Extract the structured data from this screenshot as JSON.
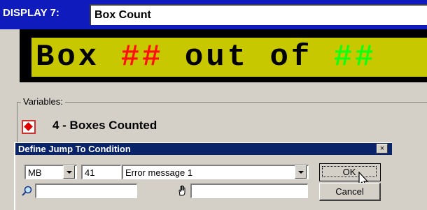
{
  "display": {
    "label": "DISPLAY 7:",
    "name": "Box Count"
  },
  "led": {
    "part1": "Box ",
    "part2": "##",
    "part3": " out of ",
    "part4": "##"
  },
  "variables": {
    "legend": "Variables:",
    "item": "4 - Boxes Counted"
  },
  "dialog": {
    "title": "Define Jump To Condition",
    "type_value": "MB",
    "number_value": "41",
    "message_value": "Error message 1",
    "ok_label": "OK",
    "cancel_label": "Cancel",
    "search_value": "",
    "hand_value": ""
  },
  "colors": {
    "title_blue": "#101bbd",
    "led_bg": "#c8c800",
    "led_red": "#ff1010",
    "led_green": "#10ff10"
  }
}
